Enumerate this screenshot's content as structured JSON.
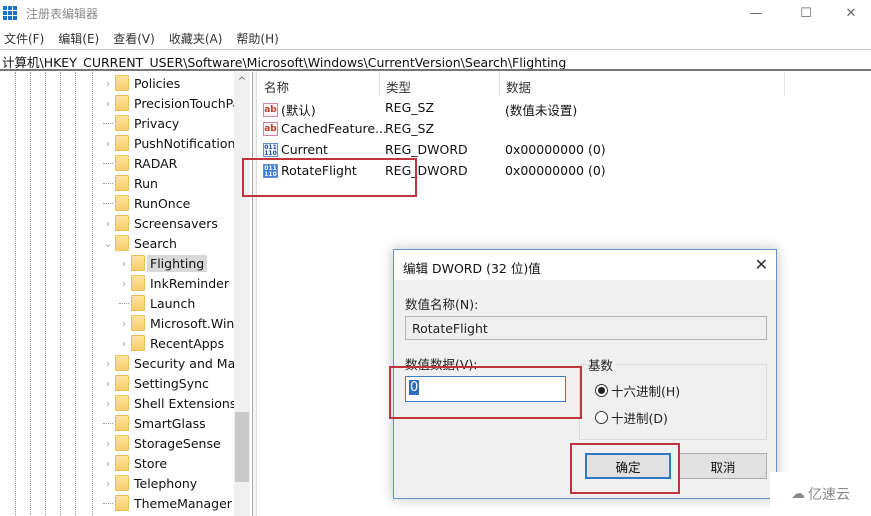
{
  "window": {
    "title": "注册表编辑器",
    "controls": {
      "minimize": "—",
      "maximize": "☐",
      "close": "✕"
    }
  },
  "menu": [
    "文件(F)",
    "编辑(E)",
    "查看(V)",
    "收藏夹(A)",
    "帮助(H)"
  ],
  "address": "计算机\\HKEY_CURRENT_USER\\Software\\Microsoft\\Windows\\CurrentVersion\\Search\\Flighting",
  "tree": [
    {
      "label": "Policies",
      "expander": "collapsed",
      "level": 0
    },
    {
      "label": "PrecisionTouchPa",
      "expander": "collapsed",
      "level": 0
    },
    {
      "label": "Privacy",
      "expander": "none",
      "level": 0
    },
    {
      "label": "PushNotifications",
      "expander": "collapsed",
      "level": 0
    },
    {
      "label": "RADAR",
      "expander": "none",
      "level": 0
    },
    {
      "label": "Run",
      "expander": "none",
      "level": 0
    },
    {
      "label": "RunOnce",
      "expander": "none",
      "level": 0
    },
    {
      "label": "Screensavers",
      "expander": "collapsed",
      "level": 0
    },
    {
      "label": "Search",
      "expander": "expanded",
      "level": 0
    },
    {
      "label": "Flighting",
      "expander": "collapsed",
      "level": 1,
      "selected": true
    },
    {
      "label": "InkReminder",
      "expander": "collapsed",
      "level": 1
    },
    {
      "label": "Launch",
      "expander": "none",
      "level": 1
    },
    {
      "label": "Microsoft.Wind",
      "expander": "collapsed",
      "level": 1
    },
    {
      "label": "RecentApps",
      "expander": "collapsed",
      "level": 1
    },
    {
      "label": "Security and Mai",
      "expander": "collapsed",
      "level": 0
    },
    {
      "label": "SettingSync",
      "expander": "collapsed",
      "level": 0
    },
    {
      "label": "Shell Extensions",
      "expander": "collapsed",
      "level": 0
    },
    {
      "label": "SmartGlass",
      "expander": "none",
      "level": 0
    },
    {
      "label": "StorageSense",
      "expander": "collapsed",
      "level": 0
    },
    {
      "label": "Store",
      "expander": "collapsed",
      "level": 0
    },
    {
      "label": "Telephony",
      "expander": "collapsed",
      "level": 0
    },
    {
      "label": "ThemeManager",
      "expander": "none",
      "level": 0
    }
  ],
  "list": {
    "columns": [
      "名称",
      "类型",
      "数据"
    ],
    "rows": [
      {
        "icon": "string-value-icon",
        "glyph": "ab",
        "name": "(默认)",
        "type": "REG_SZ",
        "data": "(数值未设置)"
      },
      {
        "icon": "string-value-icon",
        "glyph": "ab",
        "name": "CachedFeature...",
        "type": "REG_SZ",
        "data": ""
      },
      {
        "icon": "binary-value-icon",
        "glyph": "011 110",
        "name": "Current",
        "type": "REG_DWORD",
        "data": "0x00000000 (0)"
      },
      {
        "icon": "binary-value-icon",
        "glyph": "011 110",
        "name": "RotateFlight",
        "type": "REG_DWORD",
        "data": "0x00000000 (0)"
      }
    ]
  },
  "dialog": {
    "title": "编辑 DWORD (32 位)值",
    "close": "✕",
    "name_label": "数值名称(N):",
    "name_value": "RotateFlight",
    "data_label": "数值数据(V):",
    "data_value": "0",
    "base_label": "基数",
    "radios": [
      {
        "label": "十六进制(H)",
        "checked": true
      },
      {
        "label": "十进制(D)",
        "checked": false
      }
    ],
    "ok": "确定",
    "cancel": "取消"
  },
  "scrollbar": {
    "up_arrow": "^"
  },
  "watermark": "亿速云",
  "colors": {
    "annotation_red": "#c0343c",
    "accent_blue": "#2f78c4",
    "folder_yellow": "#f5cf6a"
  }
}
